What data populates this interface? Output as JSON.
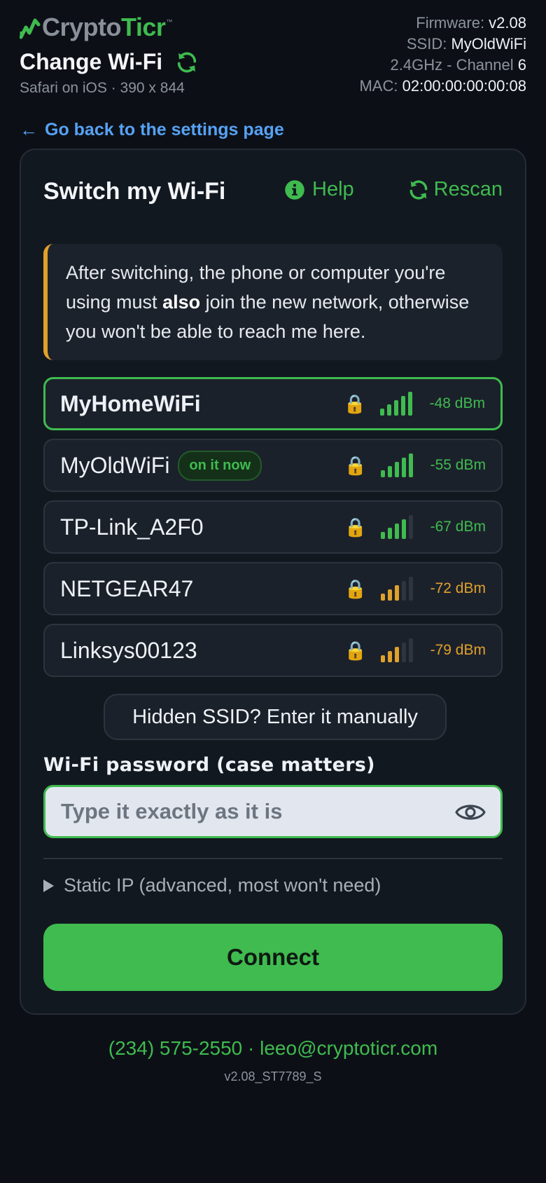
{
  "header": {
    "logo_crypto": "Crypto",
    "logo_ticr": "Ticr",
    "logo_tm": "™",
    "page_title": "Change Wi-Fi",
    "env_text": "Safari on iOS · 390 x 844"
  },
  "device": {
    "firmware_label": "Firmware: ",
    "firmware_value": "v2.08",
    "ssid_label": "SSID: ",
    "ssid_value": "MyOldWiFi",
    "band_label": "2.4GHz - Channel ",
    "band_value": "6",
    "mac_label": "MAC: ",
    "mac_value": "02:00:00:00:00:08"
  },
  "back_link": {
    "arrow": "←",
    "label": "Go back to the settings page"
  },
  "card": {
    "title": "Switch my Wi-Fi",
    "help_label": "Help",
    "rescan_label": "Rescan"
  },
  "notice": {
    "part1": "After switching, the phone or computer you're using must ",
    "bold": "also",
    "part2": " join the new network, otherwise you won't be able to reach me here."
  },
  "networks": [
    {
      "name": "MyHomeWiFi",
      "dbm": "-48 dBm",
      "bars": 5,
      "tone": "good",
      "selected": true,
      "current": false
    },
    {
      "name": "MyOldWiFi",
      "dbm": "-55 dBm",
      "bars": 5,
      "tone": "good",
      "selected": false,
      "current": true,
      "badge": "on it now"
    },
    {
      "name": "TP-Link_A2F0",
      "dbm": "-67 dBm",
      "bars": 4,
      "tone": "good",
      "selected": false,
      "current": false
    },
    {
      "name": "NETGEAR47",
      "dbm": "-72 dBm",
      "bars": 3,
      "tone": "warn",
      "selected": false,
      "current": false
    },
    {
      "name": "Linksys00123",
      "dbm": "-79 dBm",
      "bars": 3,
      "tone": "warn",
      "selected": false,
      "current": false
    }
  ],
  "icons": {
    "lock": "lock-icon",
    "signal": "signal-bars-icon"
  },
  "hidden_ssid_label": "Hidden SSID? Enter it manually",
  "password": {
    "label": "Wi-Fi password (case matters)",
    "placeholder": "Type it exactly as it is",
    "value": ""
  },
  "static_ip_label": "Static IP (advanced, most won't need)",
  "connect_label": "Connect",
  "footer": {
    "contact": "(234) 575-2550 · leeo@cryptoticr.com",
    "version": "v2.08_ST7789_S"
  },
  "colors": {
    "accent": "#3fbb4f",
    "warn": "#e0a12a",
    "link": "#56a2f5",
    "background": "#0c1016"
  }
}
